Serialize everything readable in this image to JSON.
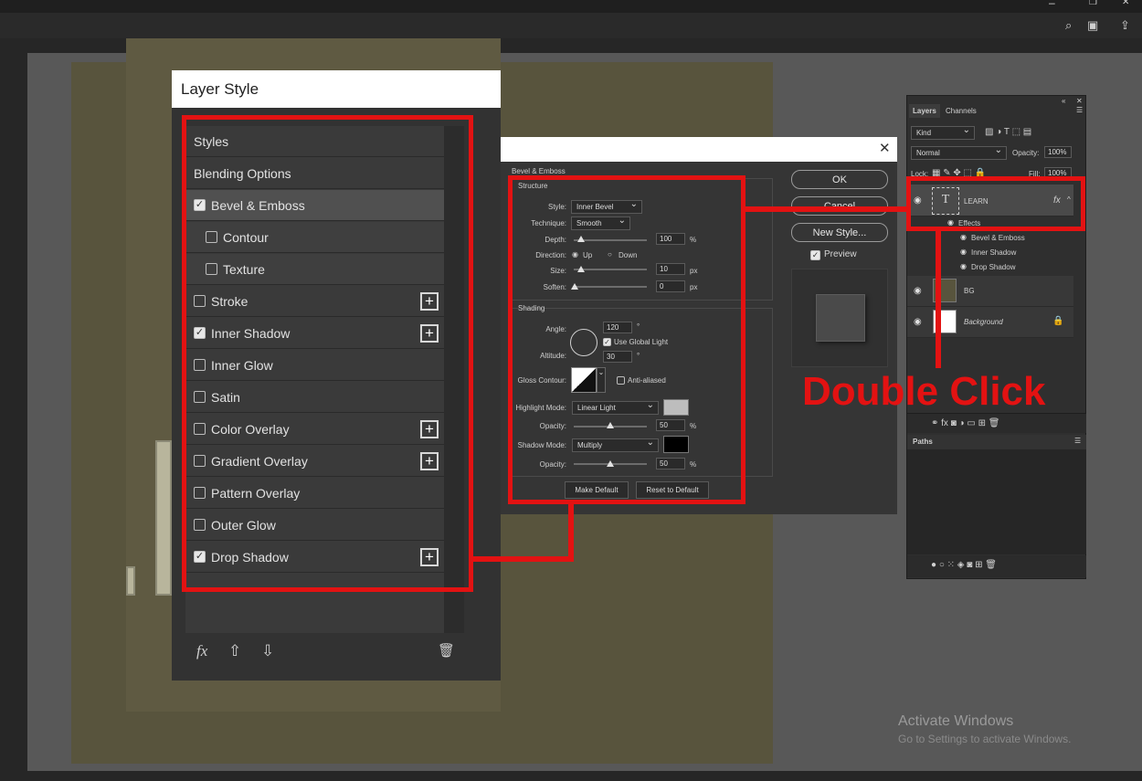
{
  "layer_style": {
    "title": "Layer Style",
    "items": [
      {
        "label": "Styles",
        "checkbox": false,
        "checked": false,
        "plus": false
      },
      {
        "label": "Blending Options",
        "checkbox": false,
        "checked": false,
        "plus": false
      },
      {
        "label": "Bevel & Emboss",
        "checkbox": true,
        "checked": true,
        "plus": false
      },
      {
        "label": "Contour",
        "checkbox": true,
        "checked": false,
        "plus": false
      },
      {
        "label": "Texture",
        "checkbox": true,
        "checked": false,
        "plus": false
      },
      {
        "label": "Stroke",
        "checkbox": true,
        "checked": false,
        "plus": true
      },
      {
        "label": "Inner Shadow",
        "checkbox": true,
        "checked": true,
        "plus": true
      },
      {
        "label": "Inner Glow",
        "checkbox": true,
        "checked": false,
        "plus": false
      },
      {
        "label": "Satin",
        "checkbox": true,
        "checked": false,
        "plus": false
      },
      {
        "label": "Color Overlay",
        "checkbox": true,
        "checked": false,
        "plus": true
      },
      {
        "label": "Gradient Overlay",
        "checkbox": true,
        "checked": false,
        "plus": true
      },
      {
        "label": "Pattern Overlay",
        "checkbox": true,
        "checked": false,
        "plus": false
      },
      {
        "label": "Outer Glow",
        "checkbox": true,
        "checked": false,
        "plus": false
      },
      {
        "label": "Drop Shadow",
        "checkbox": true,
        "checked": true,
        "plus": true
      }
    ],
    "footer": {
      "fx": "fx",
      "up": "⇧",
      "down": "⇩",
      "trash": "🗑"
    }
  },
  "bevel": {
    "section": "Bevel & Emboss",
    "structure": {
      "title": "Structure",
      "style_label": "Style:",
      "style_value": "Inner Bevel",
      "technique_label": "Technique:",
      "technique_value": "Smooth",
      "depth_label": "Depth:",
      "depth_value": "100",
      "depth_unit": "%",
      "direction_label": "Direction:",
      "up_label": "Up",
      "down_label": "Down",
      "size_label": "Size:",
      "size_value": "10",
      "size_unit": "px",
      "soften_label": "Soften:",
      "soften_value": "0",
      "soften_unit": "px"
    },
    "shading": {
      "title": "Shading",
      "angle_label": "Angle:",
      "angle_value": "120",
      "deg": "°",
      "global_light_label": "Use Global Light",
      "altitude_label": "Altitude:",
      "altitude_value": "30",
      "gloss_label": "Gloss Contour:",
      "antialiased_label": "Anti-aliased",
      "highlight_label": "Highlight Mode:",
      "highlight_value": "Linear Light",
      "highlight_color": "#bdbdbd",
      "opacity_label": "Opacity:",
      "highlight_opacity": "50",
      "pct": "%",
      "shadow_label": "Shadow Mode:",
      "shadow_value": "Multiply",
      "shadow_color": "#000000",
      "shadow_opacity": "50"
    },
    "make_default": "Make Default",
    "reset_default": "Reset to Default",
    "ok": "OK",
    "cancel": "Cancel",
    "new_style": "New Style...",
    "preview": "Preview"
  },
  "layers": {
    "tab_layers": "Layers",
    "tab_channels": "Channels",
    "kind": "Kind",
    "blend": "Normal",
    "opacity_label": "Opacity:",
    "opacity_value": "100%",
    "lock_label": "Lock:",
    "fill_label": "Fill:",
    "fill_value": "100%",
    "text_layer": "LEARN",
    "effects": "Effects",
    "effect_items": [
      "Bevel & Emboss",
      "Inner Shadow",
      "Drop Shadow"
    ],
    "bg_layer": "BG",
    "background_layer": "Background",
    "paths_tab": "Paths"
  },
  "annotation": {
    "text": "Double Click",
    "color": "#e31212"
  },
  "watermark": {
    "line1": "Activate Windows",
    "line2": "Go to Settings to activate Windows."
  }
}
